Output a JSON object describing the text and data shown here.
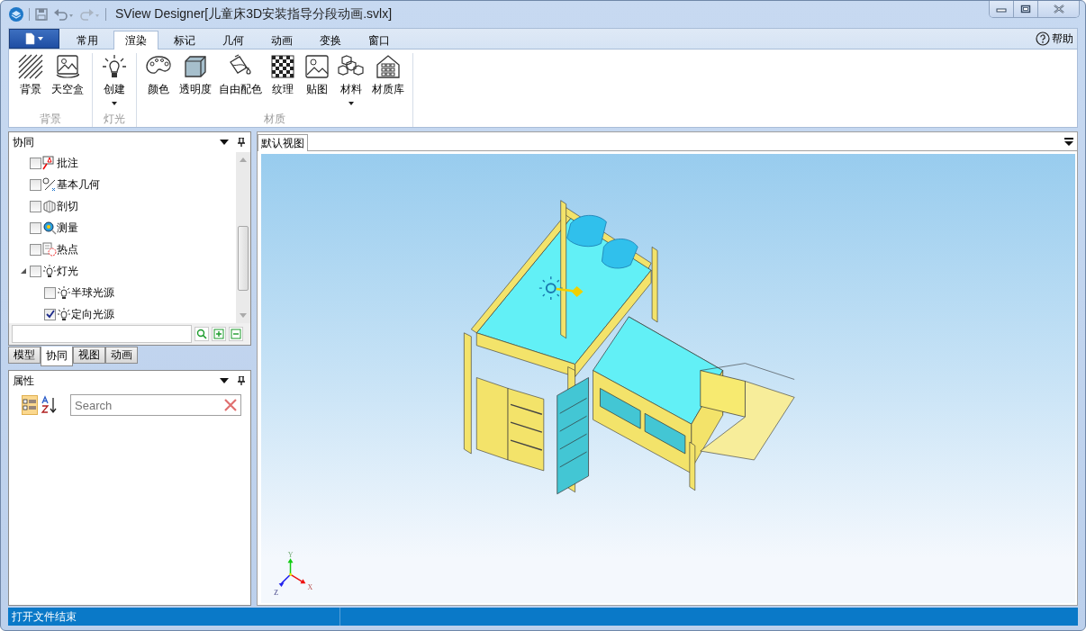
{
  "window": {
    "title": "SView Designer[儿童床3D安装指导分段动画.svlx]"
  },
  "ribbon": {
    "tabs": [
      {
        "label": "常用",
        "selected": false
      },
      {
        "label": "渲染",
        "selected": true
      },
      {
        "label": "标记",
        "selected": false
      },
      {
        "label": "几何",
        "selected": false
      },
      {
        "label": "动画",
        "selected": false
      },
      {
        "label": "变换",
        "selected": false
      },
      {
        "label": "窗口",
        "selected": false
      }
    ],
    "help": "帮助",
    "groups": [
      {
        "label": "背景",
        "items": [
          {
            "label": "背景",
            "dropdown": false
          },
          {
            "label": "天空盒",
            "dropdown": false
          }
        ]
      },
      {
        "label": "灯光",
        "items": [
          {
            "label": "创建",
            "dropdown": true
          }
        ]
      },
      {
        "label": "材质",
        "items": [
          {
            "label": "颜色",
            "dropdown": false
          },
          {
            "label": "透明度",
            "dropdown": false
          },
          {
            "label": "自由配色",
            "dropdown": false
          },
          {
            "label": "纹理",
            "dropdown": false
          },
          {
            "label": "贴图",
            "dropdown": false
          },
          {
            "label": "材料",
            "dropdown": true
          },
          {
            "label": "材质库",
            "dropdown": false
          }
        ]
      }
    ]
  },
  "tree_panel": {
    "title": "协同",
    "items": [
      {
        "label": "批注",
        "checked": false
      },
      {
        "label": "基本几何",
        "checked": false
      },
      {
        "label": "剖切",
        "checked": false
      },
      {
        "label": "测量",
        "checked": false
      },
      {
        "label": "热点",
        "checked": false
      },
      {
        "label": "灯光",
        "checked": false,
        "expanded": true,
        "children": [
          {
            "label": "半球光源",
            "checked": false
          },
          {
            "label": "定向光源",
            "checked": true
          }
        ]
      }
    ]
  },
  "panel_tabs": [
    {
      "label": "模型",
      "selected": false
    },
    {
      "label": "协同",
      "selected": true
    },
    {
      "label": "视图",
      "selected": false
    },
    {
      "label": "动画",
      "selected": false
    }
  ],
  "properties": {
    "title": "属性",
    "search": {
      "placeholder": "Search"
    }
  },
  "viewport": {
    "tabs": [
      {
        "label": "默认视图",
        "selected": true
      }
    ],
    "axes": [
      "Y",
      "X",
      "Z"
    ]
  },
  "status_bar": {
    "text": "打开文件结束"
  }
}
